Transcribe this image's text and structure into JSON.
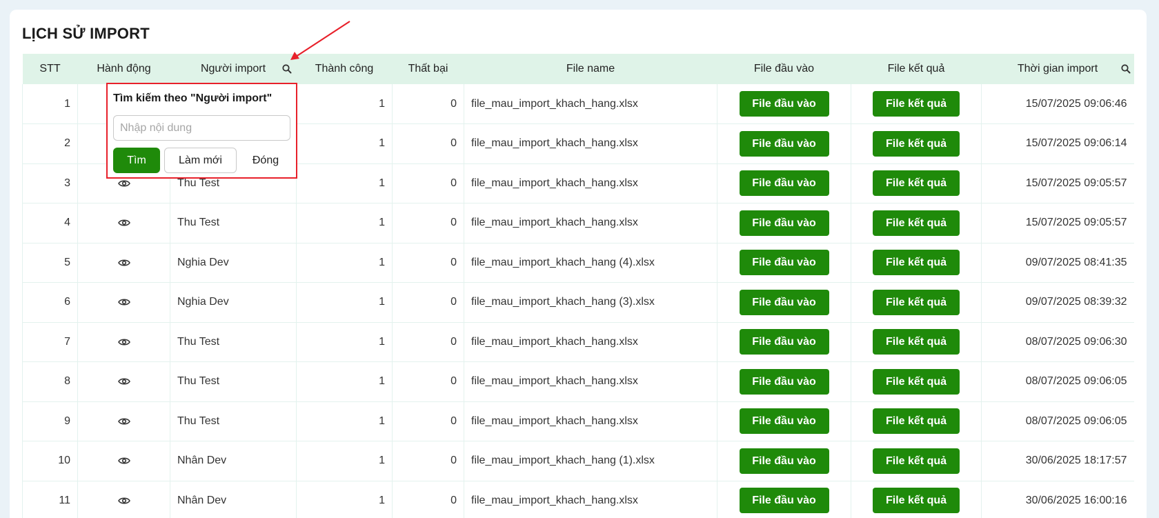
{
  "title": "LỊCH SỬ IMPORT",
  "columns": {
    "stt": "STT",
    "action": "Hành động",
    "importer": "Người import",
    "success": "Thành công",
    "failed": "Thất bại",
    "file_name": "File name",
    "input_file": "File đầu vào",
    "result_file": "File kết quả",
    "import_time": "Thời gian import"
  },
  "rows": [
    {
      "stt": "1",
      "importer": "",
      "success": "1",
      "failed": "0",
      "file": "file_mau_import_khach_hang.xlsx",
      "input_btn": "File đầu vào",
      "result_btn": "File kết quả",
      "time": "15/07/2025 09:06:46"
    },
    {
      "stt": "2",
      "importer": "",
      "success": "1",
      "failed": "0",
      "file": "file_mau_import_khach_hang.xlsx",
      "input_btn": "File đầu vào",
      "result_btn": "File kết quả",
      "time": "15/07/2025 09:06:14"
    },
    {
      "stt": "3",
      "importer": "Thu Test",
      "success": "1",
      "failed": "0",
      "file": "file_mau_import_khach_hang.xlsx",
      "input_btn": "File đầu vào",
      "result_btn": "File kết quả",
      "time": "15/07/2025 09:05:57"
    },
    {
      "stt": "4",
      "importer": "Thu Test",
      "success": "1",
      "failed": "0",
      "file": "file_mau_import_khach_hang.xlsx",
      "input_btn": "File đầu vào",
      "result_btn": "File kết quả",
      "time": "15/07/2025 09:05:57"
    },
    {
      "stt": "5",
      "importer": "Nghia Dev",
      "success": "1",
      "failed": "0",
      "file": "file_mau_import_khach_hang (4).xlsx",
      "input_btn": "File đầu vào",
      "result_btn": "File kết quả",
      "time": "09/07/2025 08:41:35"
    },
    {
      "stt": "6",
      "importer": "Nghia Dev",
      "success": "1",
      "failed": "0",
      "file": "file_mau_import_khach_hang (3).xlsx",
      "input_btn": "File đầu vào",
      "result_btn": "File kết quả",
      "time": "09/07/2025 08:39:32"
    },
    {
      "stt": "7",
      "importer": "Thu Test",
      "success": "1",
      "failed": "0",
      "file": "file_mau_import_khach_hang.xlsx",
      "input_btn": "File đầu vào",
      "result_btn": "File kết quả",
      "time": "08/07/2025 09:06:30"
    },
    {
      "stt": "8",
      "importer": "Thu Test",
      "success": "1",
      "failed": "0",
      "file": "file_mau_import_khach_hang.xlsx",
      "input_btn": "File đầu vào",
      "result_btn": "File kết quả",
      "time": "08/07/2025 09:06:05"
    },
    {
      "stt": "9",
      "importer": "Thu Test",
      "success": "1",
      "failed": "0",
      "file": "file_mau_import_khach_hang.xlsx",
      "input_btn": "File đầu vào",
      "result_btn": "File kết quả",
      "time": "08/07/2025 09:06:05"
    },
    {
      "stt": "10",
      "importer": "Nhân Dev",
      "success": "1",
      "failed": "0",
      "file": "file_mau_import_khach_hang (1).xlsx",
      "input_btn": "File đầu vào",
      "result_btn": "File kết quả",
      "time": "30/06/2025 18:17:57"
    },
    {
      "stt": "11",
      "importer": "Nhân Dev",
      "success": "1",
      "failed": "0",
      "file": "file_mau_import_khach_hang.xlsx",
      "input_btn": "File đầu vào",
      "result_btn": "File kết quả",
      "time": "30/06/2025 16:00:16"
    }
  ],
  "popup": {
    "title": "Tìm kiếm theo \"Người import\"",
    "placeholder": "Nhập nội dung",
    "search_label": "Tìm",
    "reset_label": "Làm mới",
    "close_label": "Đóng"
  },
  "icons": {
    "header_search": "search-icon",
    "row_view": "eye-icon",
    "annotation": "red-arrow"
  },
  "colors": {
    "header_bg": "#dff3e8",
    "button_green": "#1f8a0a",
    "highlight_red": "#e8202a"
  }
}
